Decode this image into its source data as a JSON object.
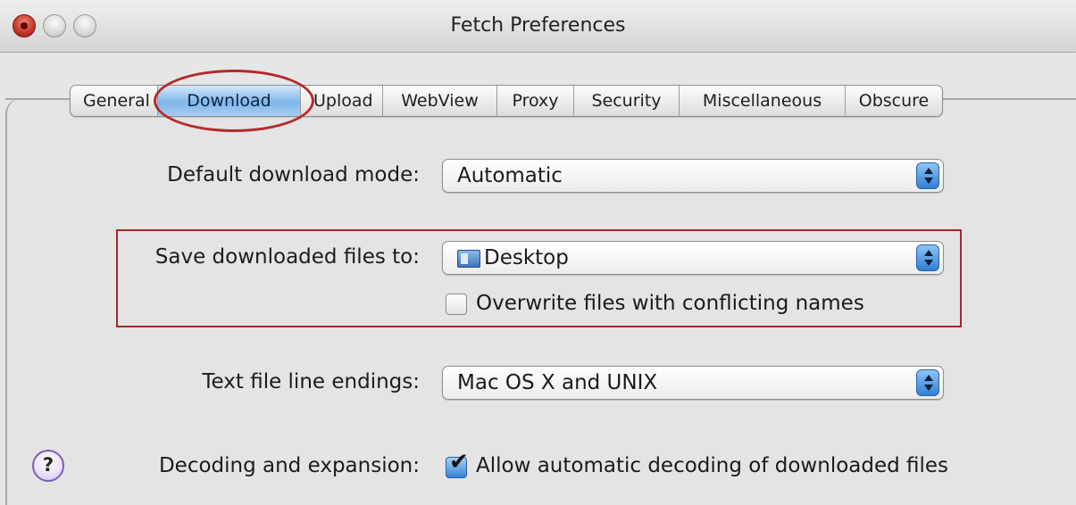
{
  "window": {
    "title": "Fetch Preferences"
  },
  "tabs": [
    {
      "label": "General",
      "selected": false
    },
    {
      "label": "Download",
      "selected": true
    },
    {
      "label": "Upload",
      "selected": false
    },
    {
      "label": "WebView",
      "selected": false
    },
    {
      "label": "Proxy",
      "selected": false
    },
    {
      "label": "Security",
      "selected": false
    },
    {
      "label": "Miscellaneous",
      "selected": false
    },
    {
      "label": "Obscure",
      "selected": false
    }
  ],
  "form": {
    "download_mode": {
      "label": "Default download mode:",
      "value": "Automatic"
    },
    "save_to": {
      "label": "Save downloaded files to:",
      "value": "Desktop",
      "icon": "desktop-folder-icon"
    },
    "overwrite": {
      "label": "Overwrite files with conflicting names",
      "checked": false
    },
    "line_endings": {
      "label": "Text file line endings:",
      "value": "Mac OS X and UNIX"
    },
    "decoding": {
      "label": "Decoding and expansion:",
      "checkbox_label": "Allow automatic decoding of downloaded files",
      "checked": true,
      "checkmark": "✔"
    }
  },
  "help": {
    "label": "?"
  },
  "colors": {
    "selected_tab": "#7fb6ea",
    "annotation": "#b52a2a",
    "close_button": "#c8392b"
  }
}
